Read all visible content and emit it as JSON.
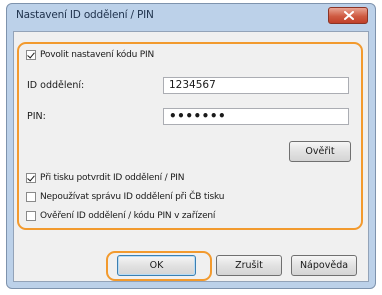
{
  "window": {
    "title": "Nastavení ID oddělení / PIN"
  },
  "settings": {
    "allow_pin_label": "Povolit nastavení kódu PIN",
    "allow_pin_checked": true,
    "dept_id_label": "ID oddělení:",
    "dept_id_value": "1234567",
    "pin_label": "PIN:",
    "pin_value": "•••••••",
    "verify_button": "Ověřit",
    "confirm_on_print_label": "Při tisku potvrdit ID oddělení / PIN",
    "confirm_on_print_checked": true,
    "no_bw_manage_label": "Nepoužívat správu ID oddělení při ČB tisku",
    "no_bw_manage_checked": false,
    "verify_at_device_label": "Ověření ID oddělení / kódu PIN v zařízení",
    "verify_at_device_checked": false
  },
  "footer": {
    "ok_button": "OK",
    "cancel_button": "Zrušit",
    "help_button": "Nápověda"
  },
  "colors": {
    "highlight": "#f29a2e",
    "close_button": "#cf5b42"
  }
}
